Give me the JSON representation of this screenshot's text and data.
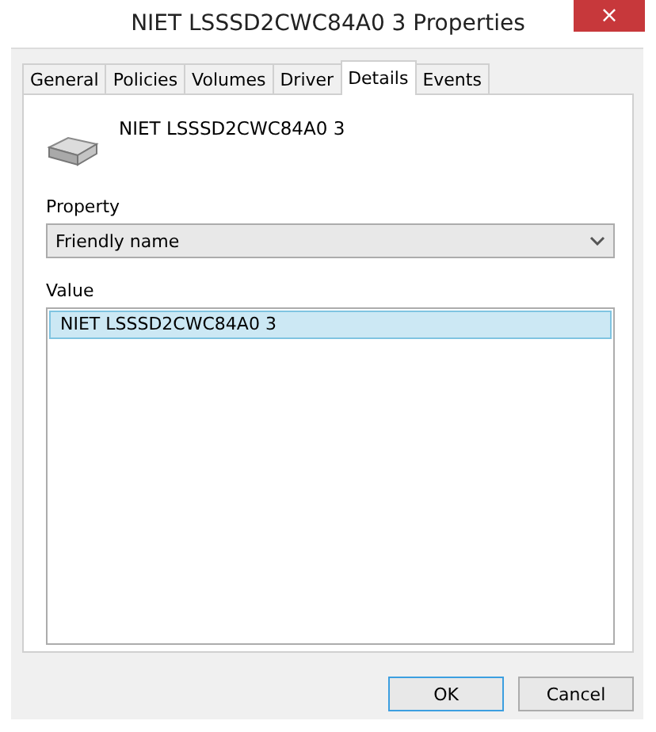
{
  "window": {
    "title": "NIET LSSSD2CWC84A0 3 Properties",
    "close": "×"
  },
  "tabs": [
    {
      "label": "General",
      "selected": false
    },
    {
      "label": "Policies",
      "selected": false
    },
    {
      "label": "Volumes",
      "selected": false
    },
    {
      "label": "Driver",
      "selected": false
    },
    {
      "label": "Details",
      "selected": true
    },
    {
      "label": "Events",
      "selected": false
    }
  ],
  "device_name": "NIET LSSSD2CWC84A0 3",
  "property": {
    "label": "Property",
    "value": "Friendly name"
  },
  "value": {
    "label": "Value",
    "items": [
      {
        "text": "NIET LSSSD2CWC84A0 3",
        "selected": true
      }
    ]
  },
  "buttons": [
    {
      "label": "OK",
      "default": true
    },
    {
      "label": "Cancel",
      "default": false
    }
  ]
}
